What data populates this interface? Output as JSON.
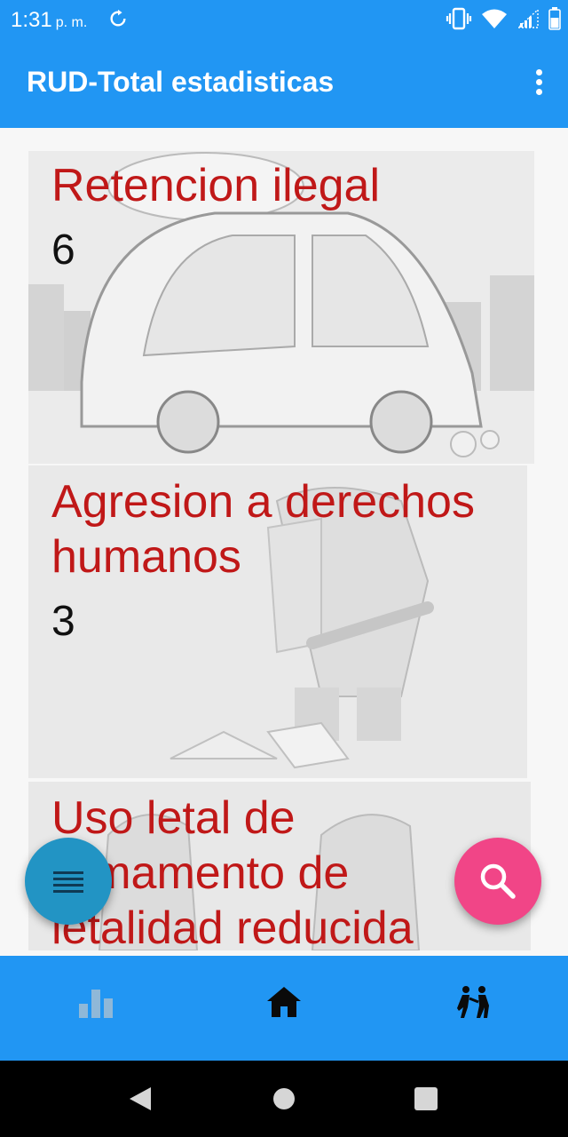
{
  "status_bar": {
    "time": "1:31",
    "ampm": "p. m."
  },
  "app_bar": {
    "title": "RUD-Total estadisticas"
  },
  "cards": [
    {
      "title": "Retencion ilegal",
      "count": "6"
    },
    {
      "title": "Agresion a derechos humanos",
      "count": "3"
    },
    {
      "title": "Uso letal de armamento de letalidad reducida",
      "count": ""
    }
  ],
  "bottom_nav": {
    "items": [
      "stats-icon",
      "home-icon",
      "police-icon"
    ],
    "active": "home-icon"
  },
  "colors": {
    "primary": "#2196f3",
    "card_title": "#c01818",
    "fab_menu": "#2294c4",
    "fab_search": "#f14587"
  }
}
